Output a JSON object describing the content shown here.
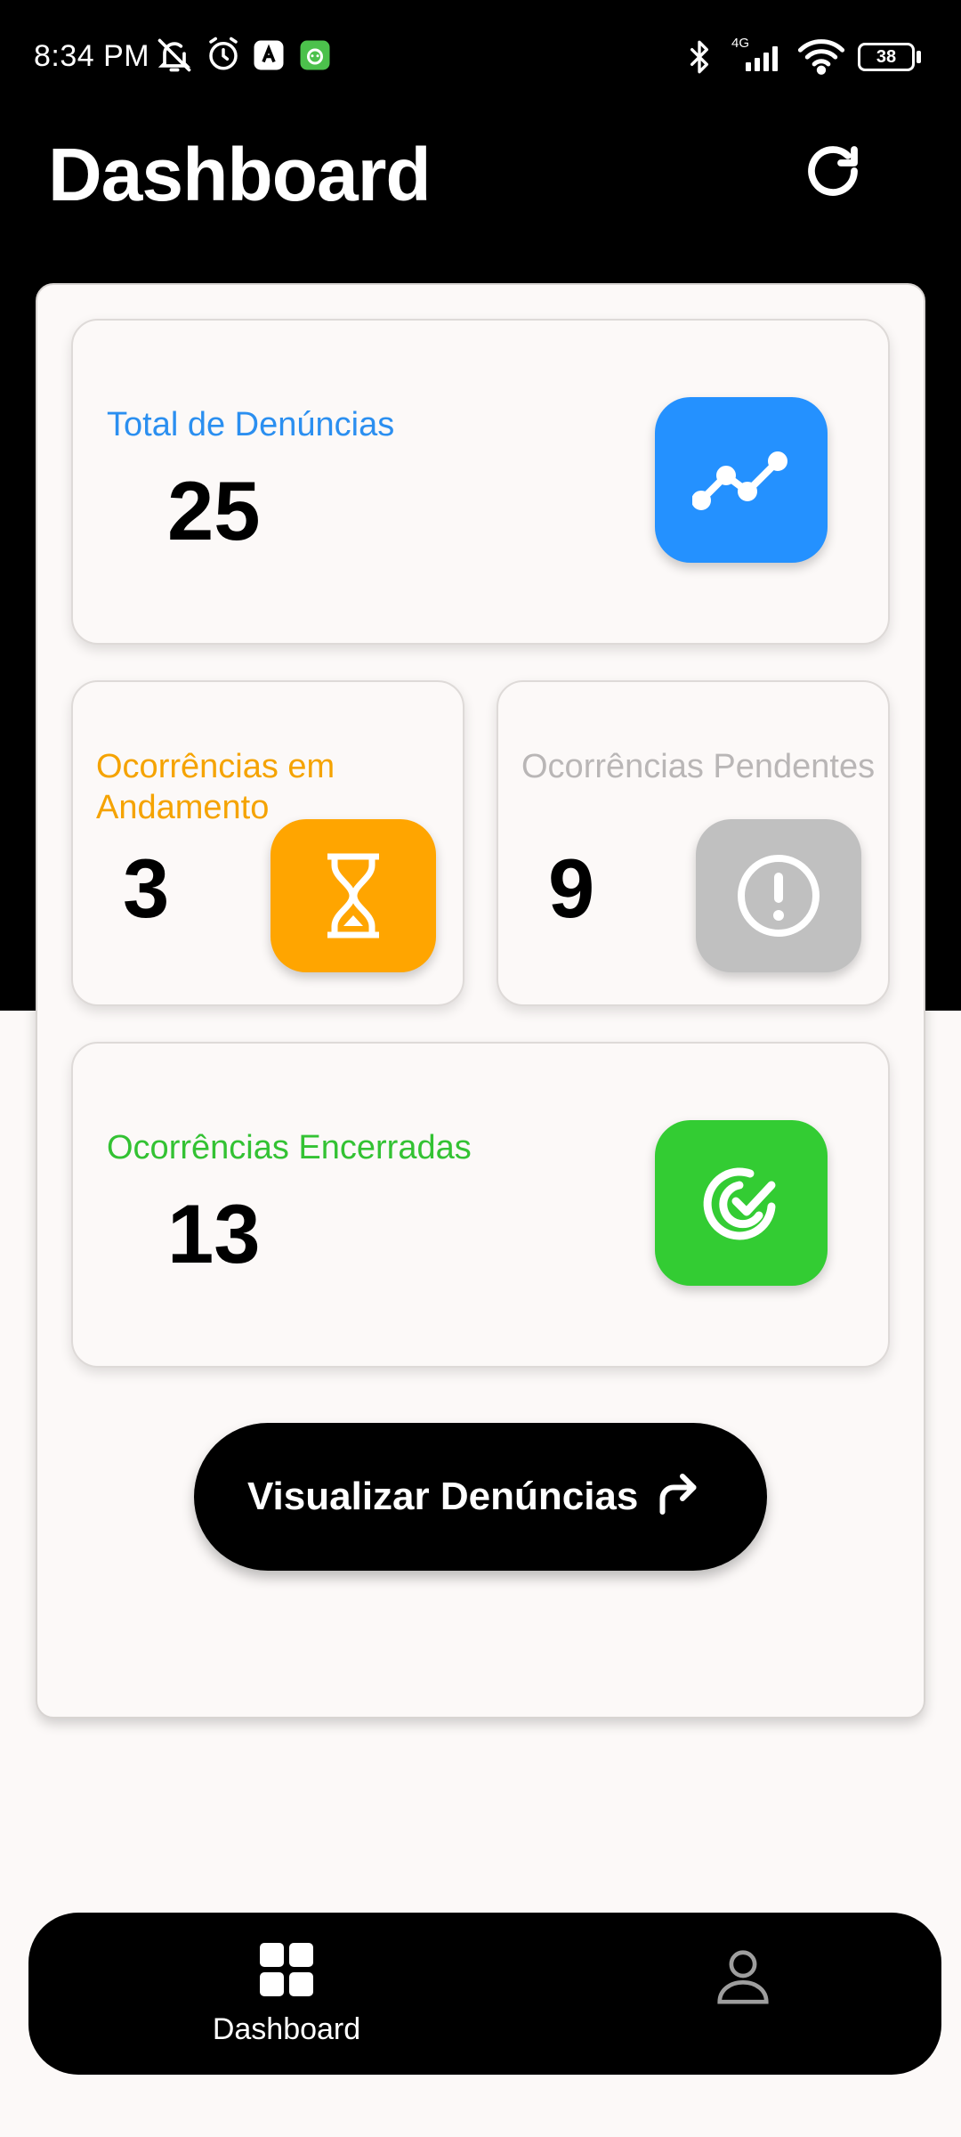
{
  "status_bar": {
    "time": "8:34 PM",
    "network": "4G",
    "battery": "38",
    "icons": [
      "mute-icon",
      "alarm-icon",
      "app-notification-icon",
      "app-notification-icon",
      "bluetooth-icon",
      "signal-icon",
      "wifi-icon",
      "battery-icon"
    ]
  },
  "header": {
    "title": "Dashboard",
    "refresh_icon": "refresh-icon"
  },
  "cards": {
    "total": {
      "label": "Total de Denúncias",
      "value": "25",
      "icon": "trend-chart-icon",
      "color": "#2491ff"
    },
    "andamento": {
      "label": "Ocorrências em Andamento",
      "value": "3",
      "icon": "hourglass-icon",
      "color": "#ffa500"
    },
    "pendentes": {
      "label": "Ocorrências Pendentes",
      "value": "9",
      "icon": "alert-circle-icon",
      "color": "#c0c0c0"
    },
    "encerradas": {
      "label": "Ocorrências Encerradas",
      "value": "13",
      "icon": "check-circle-icon",
      "color": "#33cc33"
    }
  },
  "action": {
    "label": "Visualizar Denúncias",
    "icon": "forward-arrow-icon"
  },
  "bottom_nav": {
    "items": [
      {
        "label": "Dashboard",
        "icon": "grid-icon",
        "active": true
      },
      {
        "label": "",
        "icon": "profile-icon",
        "active": false
      }
    ]
  }
}
